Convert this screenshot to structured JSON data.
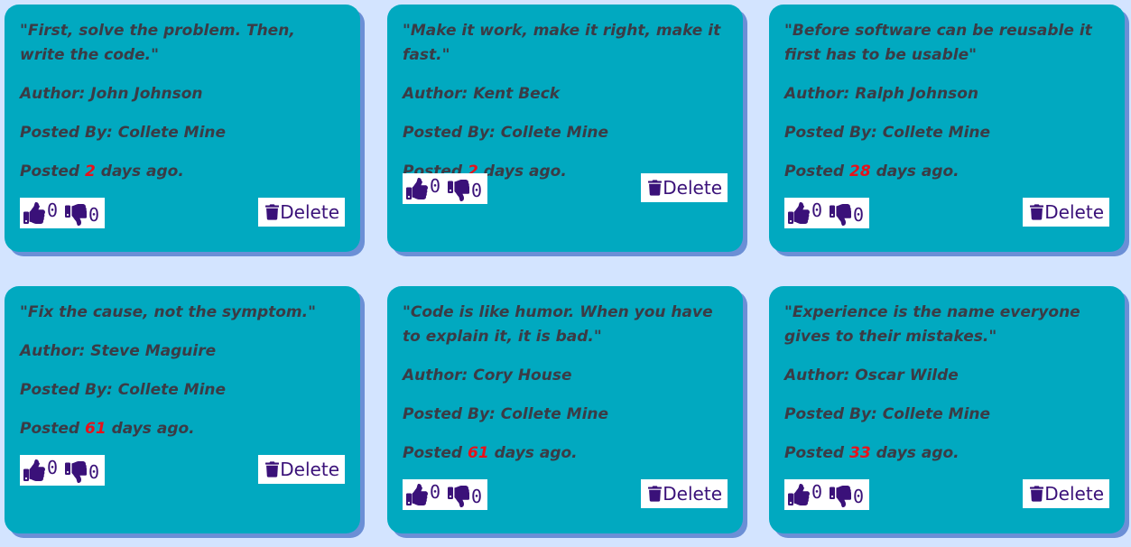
{
  "labels": {
    "author_prefix": "Author: ",
    "posted_by_prefix": "Posted By: ",
    "posted_prefix": "Posted ",
    "days_suffix": " days ago.",
    "delete": "Delete"
  },
  "colors": {
    "page_background": "#d3e4ff",
    "card_background": "#01a9c0",
    "accent": "#3a1179",
    "days_highlight": "#e8111a"
  },
  "cards": [
    {
      "quote": "\"First, solve the problem. Then, write the code.\"",
      "author": "John Johnson",
      "posted_by": "Collete Mine",
      "days": "2",
      "likes": "0",
      "dislikes": "0"
    },
    {
      "quote": "\"Make it work, make it right, make it fast.\"",
      "author": "Kent Beck",
      "posted_by": "Collete Mine",
      "days": "2",
      "likes": "0",
      "dislikes": "0"
    },
    {
      "quote": "\"Before software can be reusable it first has to be usable\"",
      "author": "Ralph Johnson",
      "posted_by": "Collete Mine",
      "days": "28",
      "likes": "0",
      "dislikes": "0"
    },
    {
      "quote": "\"Fix the cause, not the symptom.\"",
      "author": "Steve Maguire",
      "posted_by": "Collete Mine",
      "days": "61",
      "likes": "0",
      "dislikes": "0"
    },
    {
      "quote": "\"Code is like humor. When you have to explain it, it is bad.\"",
      "author": "Cory House",
      "posted_by": "Collete Mine",
      "days": "61",
      "likes": "0",
      "dislikes": "0"
    },
    {
      "quote": "\"Experience is the name everyone gives to their mistakes.\"",
      "author": "Oscar Wilde",
      "posted_by": "Collete Mine",
      "days": "33",
      "likes": "0",
      "dislikes": "0"
    }
  ]
}
